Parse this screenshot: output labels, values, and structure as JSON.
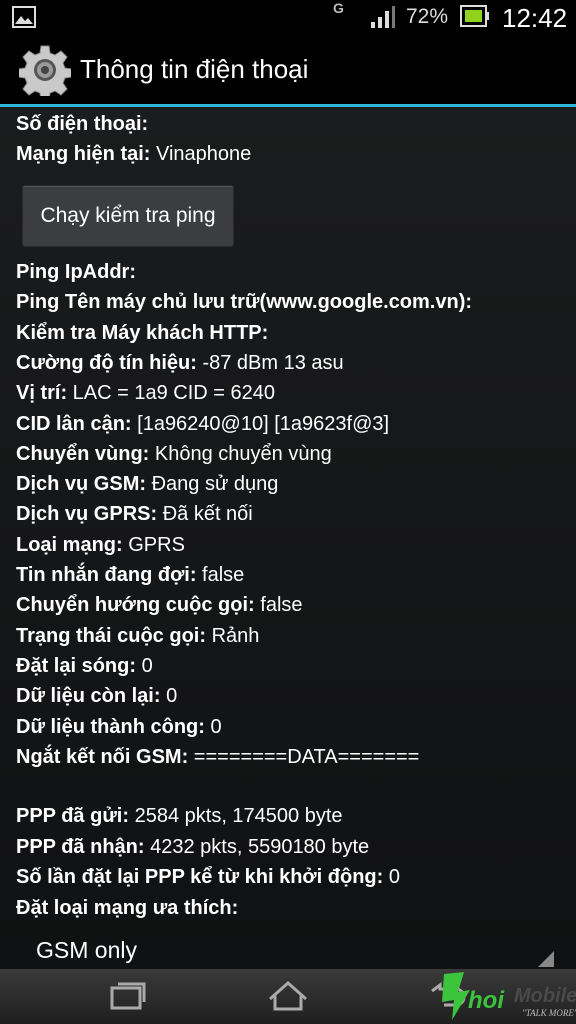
{
  "status_bar": {
    "network_type": "G",
    "battery_percent": "72%",
    "clock": "12:42"
  },
  "action_bar": {
    "title": "Thông tin điện thoại",
    "icon": "gear-icon"
  },
  "info_top": [
    {
      "label": "Số điện thoại:",
      "value": ""
    },
    {
      "label": "Mạng hiện tại:",
      "value": " Vinaphone"
    }
  ],
  "ping_button": {
    "label": "Chạy kiểm tra ping"
  },
  "info_list": [
    {
      "label": "Ping IpAddr:",
      "value": ""
    },
    {
      "label": "Ping Tên máy chủ lưu trữ(www.google.com.vn):",
      "value": ""
    },
    {
      "label": "Kiểm tra Máy khách HTTP:",
      "value": ""
    },
    {
      "label": "Cường độ tín hiệu:",
      "value": " -87 dBm   13 asu"
    },
    {
      "label": "Vị trí:",
      "value": " LAC = 1a9   CID = 6240"
    },
    {
      "label": "CID lân cận:",
      "value": " [1a96240@10] [1a9623f@3]"
    },
    {
      "label": "Chuyển vùng:",
      "value": " Không chuyển vùng"
    },
    {
      "label": "Dịch vụ GSM:",
      "value": " Đang sử dụng"
    },
    {
      "label": "Dịch vụ GPRS:",
      "value": " Đã kết nối"
    },
    {
      "label": "Loại mạng:",
      "value": " GPRS"
    },
    {
      "label": "Tin nhắn đang đợi:",
      "value": " false"
    },
    {
      "label": "Chuyển hướng cuộc gọi:",
      "value": " false"
    },
    {
      "label": "Trạng thái cuộc gọi:",
      "value": " Rảnh"
    },
    {
      "label": "Đặt lại sóng:",
      "value": " 0"
    },
    {
      "label": "Dữ liệu còn lại:",
      "value": " 0"
    },
    {
      "label": "Dữ liệu thành công:",
      "value": " 0"
    },
    {
      "label": "Ngắt kết nối GSM:",
      "value": " ========DATA======="
    }
  ],
  "ppp_list": [
    {
      "label": "PPP đã gửi:",
      "value": " 2584 pkts, 174500 byte"
    },
    {
      "label": "PPP đã nhận:",
      "value": " 4232 pkts, 5590180 byte"
    },
    {
      "label": "Số lần đặt lại PPP kể từ khi khởi động:",
      "value": " 0"
    },
    {
      "label": "Đặt loại mạng ưa thích:",
      "value": ""
    }
  ],
  "network_select": {
    "selected": "GSM only"
  },
  "watermark": {
    "brand": "Khoi Mobile",
    "slogan": "TALK MORE"
  },
  "colors": {
    "accent": "#2fb6d8",
    "battery_fill": "#8fd21e"
  }
}
